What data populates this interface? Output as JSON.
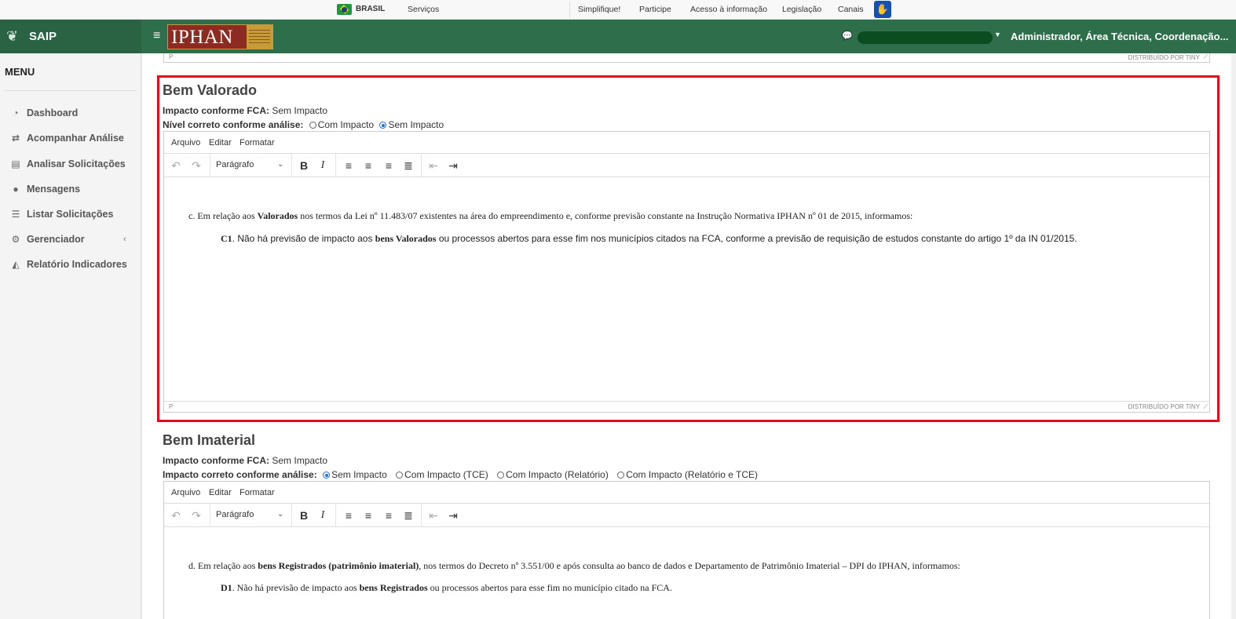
{
  "govbar": {
    "country": "BRASIL",
    "services": "Serviços",
    "links": [
      "Simplifique!",
      "Participe",
      "Acesso à informação",
      "Legislação",
      "Canais"
    ],
    "accessibility_icon": "vlibras-hand-icon"
  },
  "header": {
    "app_name": "SAIP",
    "org_logo": "IPHAN",
    "user_role": "Administrador, Área Técnica, Coordenação..."
  },
  "sidebar": {
    "title": "MENU",
    "items": [
      {
        "label": "Dashboard",
        "icon": "dashboard-icon"
      },
      {
        "label": "Acompanhar Análise",
        "icon": "exchange-icon"
      },
      {
        "label": "Analisar Solicitações",
        "icon": "book-icon"
      },
      {
        "label": "Mensagens",
        "icon": "comments-icon"
      },
      {
        "label": "Listar Solicitações",
        "icon": "list-icon"
      },
      {
        "label": "Gerenciador",
        "icon": "cogs-icon"
      },
      {
        "label": "Relatório Indicadores",
        "icon": "area-chart-icon"
      }
    ]
  },
  "editor_common": {
    "menu": [
      "Arquivo",
      "Editar",
      "Formatar"
    ],
    "format_select": "Parágrafo",
    "status_path": "P",
    "powered_by": "DISTRIBUÍDO POR TINY"
  },
  "bem_valorado": {
    "title": "Bem Valorado",
    "impacto_label": "Impacto conforme FCA:",
    "impacto_value": "Sem Impacto",
    "nivel_label": "Nível correto conforme análise:",
    "options": [
      "Com Impacto",
      "Sem Impacto"
    ],
    "selected": "Sem Impacto",
    "line1_pre": "c. Em relação aos ",
    "line1_bold": "Valorados",
    "line1_post": " nos termos da Lei nº 11.483/07 existentes na área do empreendimento e, conforme previsão constante na Instrução Normativa IPHAN nº 01 de 2015, informamos:",
    "line2_code": "C1",
    "line2_pre": ". Não há previsão de impacto aos ",
    "line2_bold": "bens Valorados",
    "line2_post": " ou processos abertos para esse fim nos municípios citados na FCA, conforme a previsão de requisição de estudos constante do artigo 1º da IN 01/2015."
  },
  "bem_imaterial": {
    "title": "Bem Imaterial",
    "impacto_label": "Impacto conforme FCA:",
    "impacto_value": "Sem Impacto",
    "nivel_label": "Impacto correto conforme análise:",
    "options": [
      "Sem Impacto",
      "Com Impacto (TCE)",
      "Com Impacto (Relatório)",
      "Com Impacto (Relatório e TCE)"
    ],
    "selected": "Sem Impacto",
    "line1_pre": "d. Em relação aos ",
    "line1_bold": "bens Registrados (patrimônio imaterial)",
    "line1_post": ", nos termos do Decreto nº 3.551/00 e após consulta ao banco de dados e Departamento de Patrimônio Imaterial – DPI do IPHAN, informamos:",
    "line2_code": "D1",
    "line2_pre": ". Não há previsão de impacto aos ",
    "line2_bold": "bens Registrados",
    "line2_post": " ou processos abertos para esse fim no município citado na FCA."
  },
  "colors": {
    "header_green": "#2e6e4a",
    "highlight_red": "#e10b1e",
    "iphan_red": "#8b2b22",
    "iphan_gold": "#c79b3a"
  }
}
